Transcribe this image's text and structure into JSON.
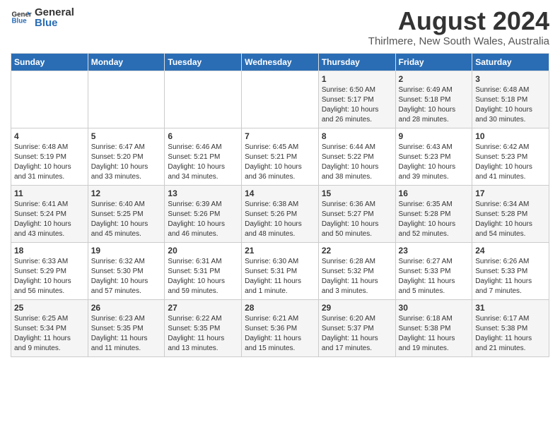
{
  "header": {
    "logo_general": "General",
    "logo_blue": "Blue",
    "main_title": "August 2024",
    "subtitle": "Thirlmere, New South Wales, Australia"
  },
  "days_of_week": [
    "Sunday",
    "Monday",
    "Tuesday",
    "Wednesday",
    "Thursday",
    "Friday",
    "Saturday"
  ],
  "weeks": [
    [
      {
        "day": "",
        "info": ""
      },
      {
        "day": "",
        "info": ""
      },
      {
        "day": "",
        "info": ""
      },
      {
        "day": "",
        "info": ""
      },
      {
        "day": "1",
        "info": "Sunrise: 6:50 AM\nSunset: 5:17 PM\nDaylight: 10 hours\nand 26 minutes."
      },
      {
        "day": "2",
        "info": "Sunrise: 6:49 AM\nSunset: 5:18 PM\nDaylight: 10 hours\nand 28 minutes."
      },
      {
        "day": "3",
        "info": "Sunrise: 6:48 AM\nSunset: 5:18 PM\nDaylight: 10 hours\nand 30 minutes."
      }
    ],
    [
      {
        "day": "4",
        "info": "Sunrise: 6:48 AM\nSunset: 5:19 PM\nDaylight: 10 hours\nand 31 minutes."
      },
      {
        "day": "5",
        "info": "Sunrise: 6:47 AM\nSunset: 5:20 PM\nDaylight: 10 hours\nand 33 minutes."
      },
      {
        "day": "6",
        "info": "Sunrise: 6:46 AM\nSunset: 5:21 PM\nDaylight: 10 hours\nand 34 minutes."
      },
      {
        "day": "7",
        "info": "Sunrise: 6:45 AM\nSunset: 5:21 PM\nDaylight: 10 hours\nand 36 minutes."
      },
      {
        "day": "8",
        "info": "Sunrise: 6:44 AM\nSunset: 5:22 PM\nDaylight: 10 hours\nand 38 minutes."
      },
      {
        "day": "9",
        "info": "Sunrise: 6:43 AM\nSunset: 5:23 PM\nDaylight: 10 hours\nand 39 minutes."
      },
      {
        "day": "10",
        "info": "Sunrise: 6:42 AM\nSunset: 5:23 PM\nDaylight: 10 hours\nand 41 minutes."
      }
    ],
    [
      {
        "day": "11",
        "info": "Sunrise: 6:41 AM\nSunset: 5:24 PM\nDaylight: 10 hours\nand 43 minutes."
      },
      {
        "day": "12",
        "info": "Sunrise: 6:40 AM\nSunset: 5:25 PM\nDaylight: 10 hours\nand 45 minutes."
      },
      {
        "day": "13",
        "info": "Sunrise: 6:39 AM\nSunset: 5:26 PM\nDaylight: 10 hours\nand 46 minutes."
      },
      {
        "day": "14",
        "info": "Sunrise: 6:38 AM\nSunset: 5:26 PM\nDaylight: 10 hours\nand 48 minutes."
      },
      {
        "day": "15",
        "info": "Sunrise: 6:36 AM\nSunset: 5:27 PM\nDaylight: 10 hours\nand 50 minutes."
      },
      {
        "day": "16",
        "info": "Sunrise: 6:35 AM\nSunset: 5:28 PM\nDaylight: 10 hours\nand 52 minutes."
      },
      {
        "day": "17",
        "info": "Sunrise: 6:34 AM\nSunset: 5:28 PM\nDaylight: 10 hours\nand 54 minutes."
      }
    ],
    [
      {
        "day": "18",
        "info": "Sunrise: 6:33 AM\nSunset: 5:29 PM\nDaylight: 10 hours\nand 56 minutes."
      },
      {
        "day": "19",
        "info": "Sunrise: 6:32 AM\nSunset: 5:30 PM\nDaylight: 10 hours\nand 57 minutes."
      },
      {
        "day": "20",
        "info": "Sunrise: 6:31 AM\nSunset: 5:31 PM\nDaylight: 10 hours\nand 59 minutes."
      },
      {
        "day": "21",
        "info": "Sunrise: 6:30 AM\nSunset: 5:31 PM\nDaylight: 11 hours\nand 1 minute."
      },
      {
        "day": "22",
        "info": "Sunrise: 6:28 AM\nSunset: 5:32 PM\nDaylight: 11 hours\nand 3 minutes."
      },
      {
        "day": "23",
        "info": "Sunrise: 6:27 AM\nSunset: 5:33 PM\nDaylight: 11 hours\nand 5 minutes."
      },
      {
        "day": "24",
        "info": "Sunrise: 6:26 AM\nSunset: 5:33 PM\nDaylight: 11 hours\nand 7 minutes."
      }
    ],
    [
      {
        "day": "25",
        "info": "Sunrise: 6:25 AM\nSunset: 5:34 PM\nDaylight: 11 hours\nand 9 minutes."
      },
      {
        "day": "26",
        "info": "Sunrise: 6:23 AM\nSunset: 5:35 PM\nDaylight: 11 hours\nand 11 minutes."
      },
      {
        "day": "27",
        "info": "Sunrise: 6:22 AM\nSunset: 5:35 PM\nDaylight: 11 hours\nand 13 minutes."
      },
      {
        "day": "28",
        "info": "Sunrise: 6:21 AM\nSunset: 5:36 PM\nDaylight: 11 hours\nand 15 minutes."
      },
      {
        "day": "29",
        "info": "Sunrise: 6:20 AM\nSunset: 5:37 PM\nDaylight: 11 hours\nand 17 minutes."
      },
      {
        "day": "30",
        "info": "Sunrise: 6:18 AM\nSunset: 5:38 PM\nDaylight: 11 hours\nand 19 minutes."
      },
      {
        "day": "31",
        "info": "Sunrise: 6:17 AM\nSunset: 5:38 PM\nDaylight: 11 hours\nand 21 minutes."
      }
    ]
  ]
}
